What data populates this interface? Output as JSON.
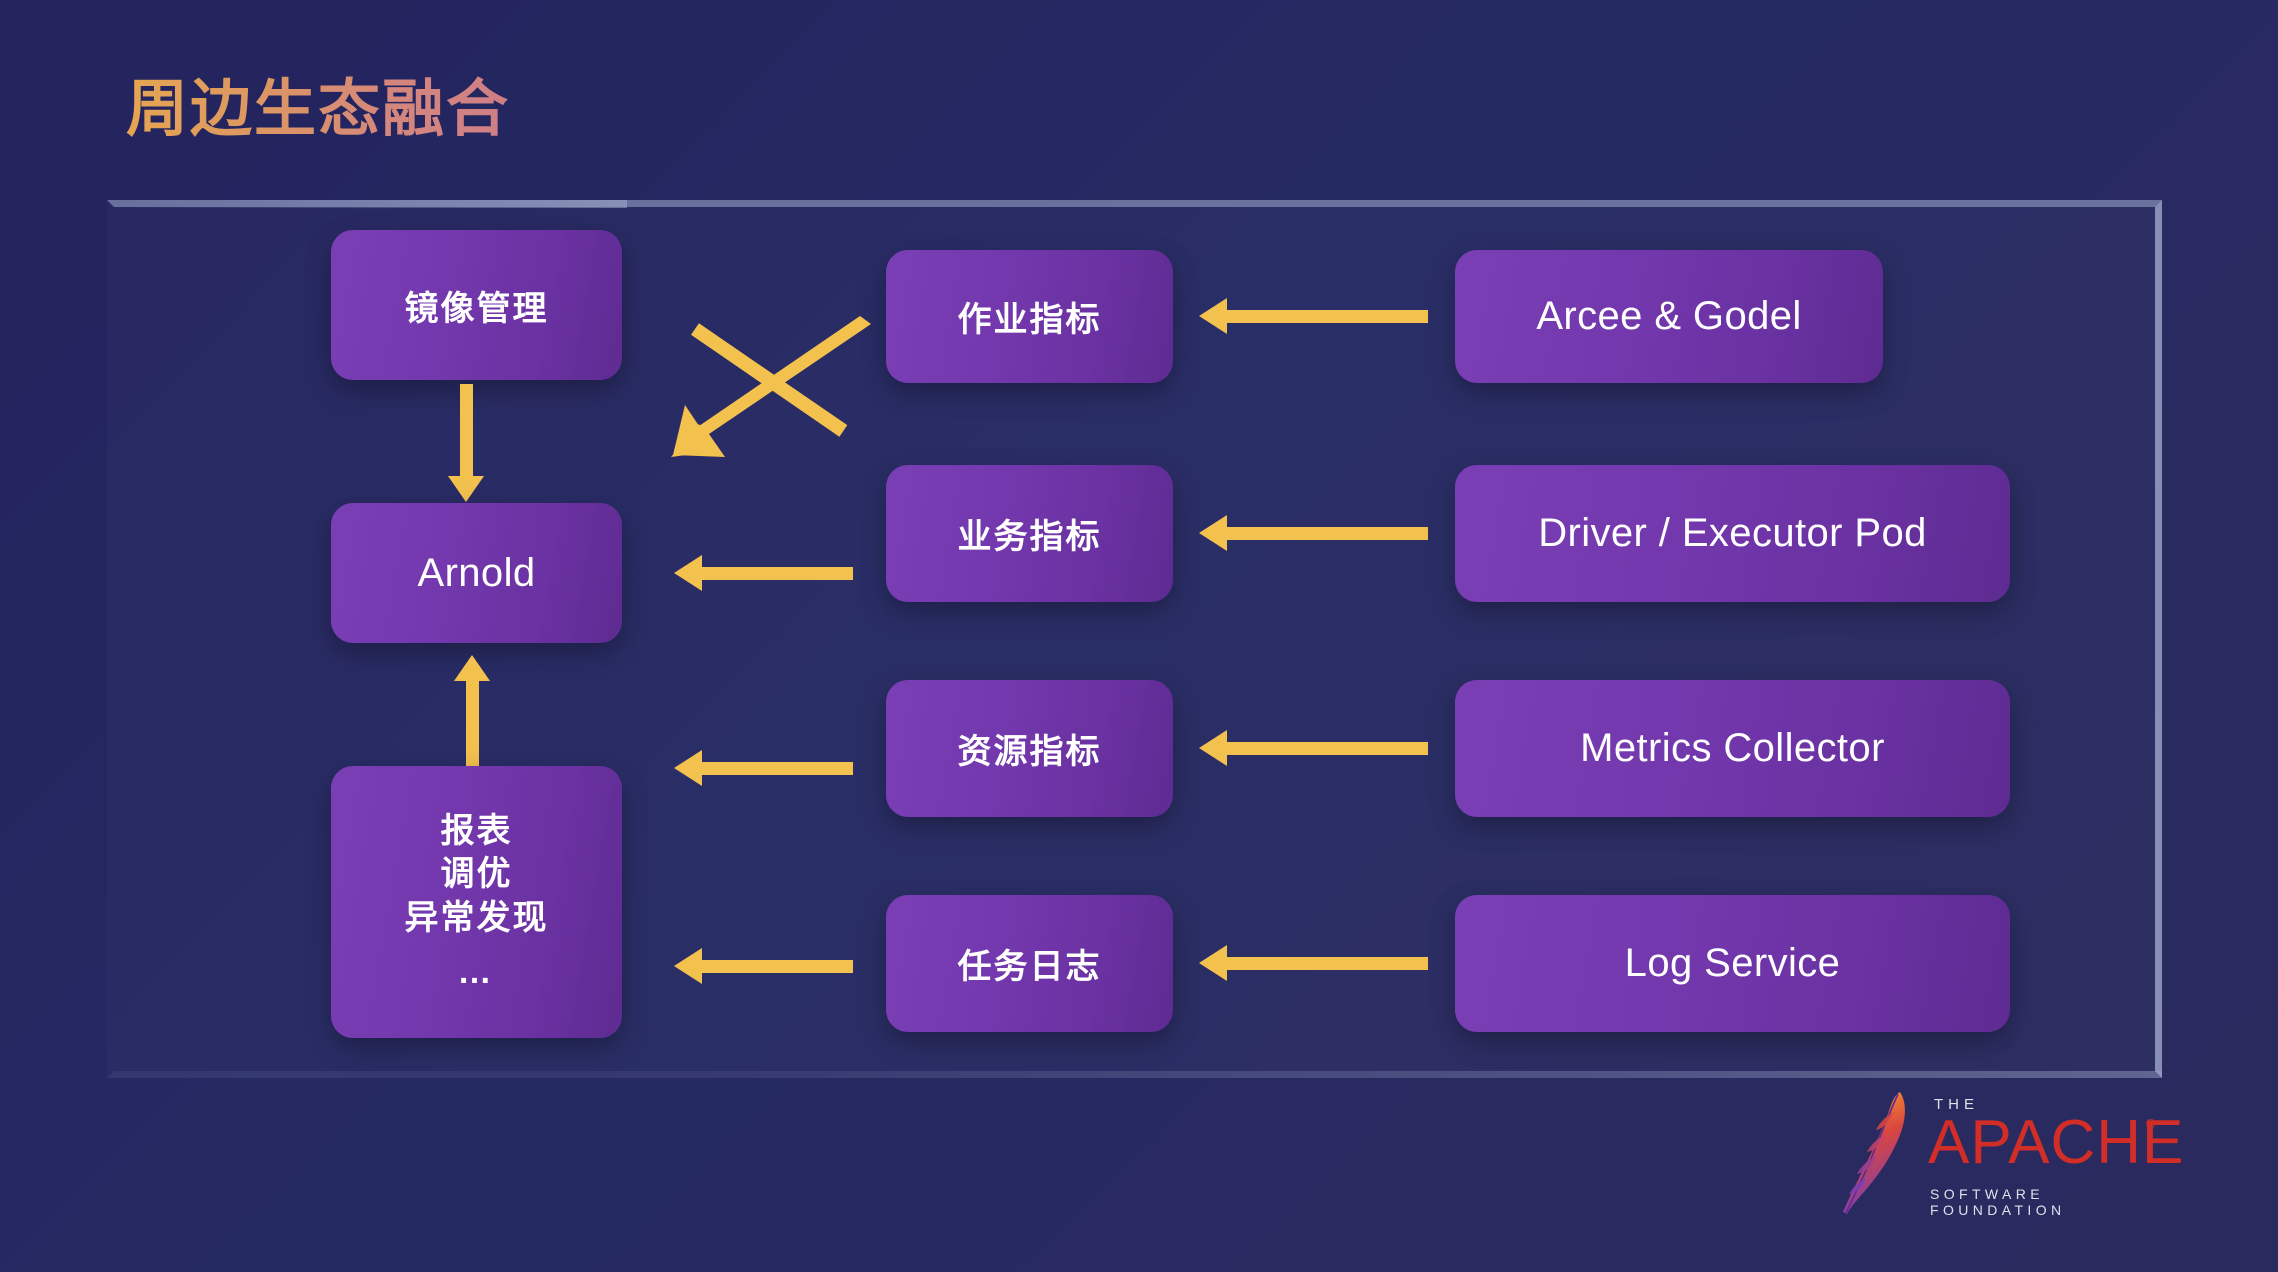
{
  "slide": {
    "title": "周边生态融合",
    "background_color": "#26265e",
    "accent_color": "#f3c14e",
    "node_color_start": "#7b3fb5",
    "node_color_end": "#5e2b92",
    "frame_border_color": "#a0aacd",
    "title_gradient_start": "#e6a551",
    "title_gradient_end": "#cf7f86"
  },
  "left_column": {
    "image_management": "镜像管理",
    "arnold": "Arnold",
    "reports": {
      "line1": "报表",
      "line2": "调优",
      "line3": "异常发现",
      "line4": "…"
    }
  },
  "middle_column": {
    "job_metrics": "作业指标",
    "business_metrics": "业务指标",
    "resource_metrics": "资源指标",
    "task_logs": "任务日志"
  },
  "right_column": {
    "arcee_godel": "Arcee & Godel",
    "driver_executor_pod": "Driver / Executor Pod",
    "metrics_collector": "Metrics Collector",
    "log_service": "Log Service"
  },
  "logo": {
    "the": "THE",
    "apache": "APACHE",
    "registered": "®",
    "software_foundation": "SOFTWARE FOUNDATION"
  }
}
